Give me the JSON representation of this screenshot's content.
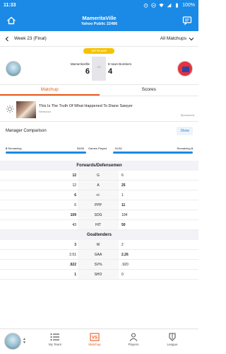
{
  "status": {
    "time": "11:33",
    "battery": "100%"
  },
  "header": {
    "title": "MameritaVille",
    "subtitle": "Yahoo Public 22486"
  },
  "week": {
    "label": "Week 23 (Final)",
    "filter": "All Matchups"
  },
  "matchup": {
    "badge": "1ST PLACE",
    "team1": {
      "name": "MameritaVille",
      "score": "6"
    },
    "team2": {
      "name": "E-town Bombers",
      "score": "4"
    },
    "vs": "VS"
  },
  "tabs": [
    {
      "label": "Matchup"
    },
    {
      "label": "Scores"
    }
  ],
  "ad": {
    "headline": "This Is The Truth Of What Happened To Diane Sawyer",
    "source": "Newsrool",
    "sponsored": "Sponsored"
  },
  "manager": {
    "label": "Manager Comparison",
    "show": "Show"
  },
  "remaining": {
    "left_label": "Remaining",
    "left_value": "0",
    "left_count": "55/55",
    "games_played": "Games Played",
    "right_count": "51/51",
    "right_label": "Remaining",
    "right_value": "0"
  },
  "sections": [
    {
      "title": "Forwards/Defensemen",
      "rows": [
        {
          "cat": "G",
          "left": "12",
          "right": "6",
          "winner": "left"
        },
        {
          "cat": "A",
          "left": "12",
          "right": "25",
          "winner": "right"
        },
        {
          "cat": "+/-",
          "left": "6",
          "right": "1",
          "winner": "left"
        },
        {
          "cat": "PPP",
          "left": "6",
          "right": "11",
          "winner": "right"
        },
        {
          "cat": "SOG",
          "left": "109",
          "right": "104",
          "winner": "left"
        },
        {
          "cat": "HIT",
          "left": "43",
          "right": "50",
          "winner": "right"
        }
      ]
    },
    {
      "title": "Goaltenders",
      "rows": [
        {
          "cat": "W",
          "left": "3",
          "right": "2",
          "winner": "left"
        },
        {
          "cat": "GAA",
          "left": "2.51",
          "right": "2.26",
          "winner": "right"
        },
        {
          "cat": "SV%",
          "left": ".922",
          "right": ".920",
          "winner": "left"
        },
        {
          "cat": "SHO",
          "left": "1",
          "right": "0",
          "winner": "left"
        }
      ]
    }
  ],
  "tabbar": {
    "items": [
      {
        "label": "My Team"
      },
      {
        "label": "Matchup"
      },
      {
        "label": "Players"
      },
      {
        "label": "League"
      }
    ]
  },
  "colors": {
    "brand": "#1a8ae6",
    "accent": "#ea5a1f",
    "badge": "#f5c200"
  }
}
